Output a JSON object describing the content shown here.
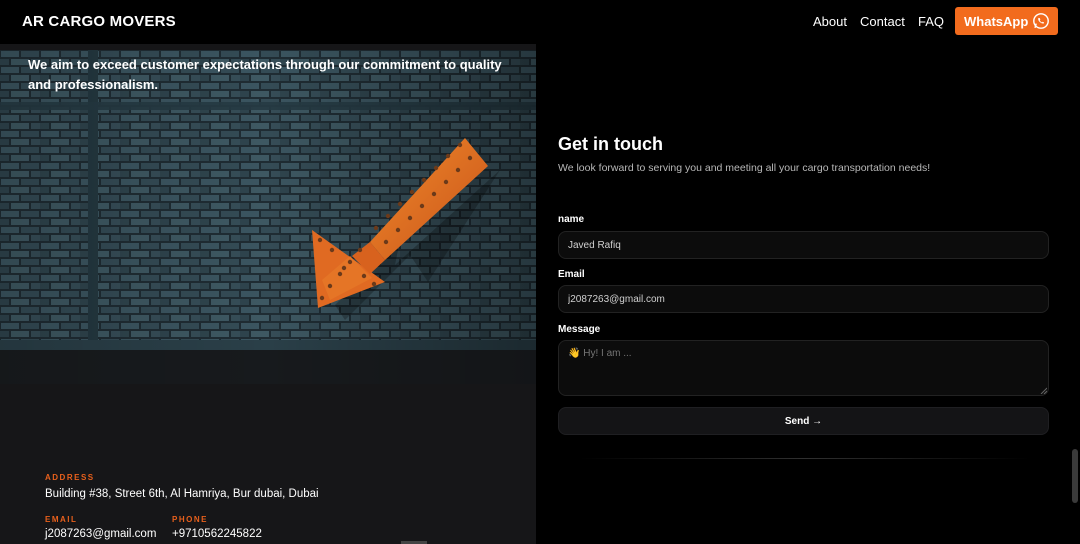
{
  "header": {
    "brand": "AR CARGO MOVERS",
    "nav": [
      "About",
      "Contact",
      "FAQ"
    ],
    "whatsapp_label": "WhatsApp"
  },
  "hero": {
    "tagline": "We aim to exceed customer expectations through our commitment to quality and professionalism."
  },
  "info": {
    "address_label": "ADDRESS",
    "address": "Building #38, Street 6th, Al Hamriya, Bur dubai, Dubai",
    "email_label": "EMAIL",
    "email": "j2087263@gmail.com",
    "phone_label": "PHONE",
    "phone": "+9710562245822"
  },
  "form": {
    "title": "Get in touch",
    "subtitle": "We look forward to serving you and meeting all your cargo transportation needs!",
    "name_label": "name",
    "name_value": "Javed Rafiq",
    "email_label": "Email",
    "email_value": "j2087263@gmail.com",
    "message_label": "Message",
    "message_placeholder": "👋 Hy! I am ...",
    "send_label": "Send →"
  },
  "colors": {
    "accent": "#f26b1d",
    "background": "#000000",
    "panel": "#161618"
  },
  "icons": {
    "whatsapp": "whatsapp-icon"
  }
}
